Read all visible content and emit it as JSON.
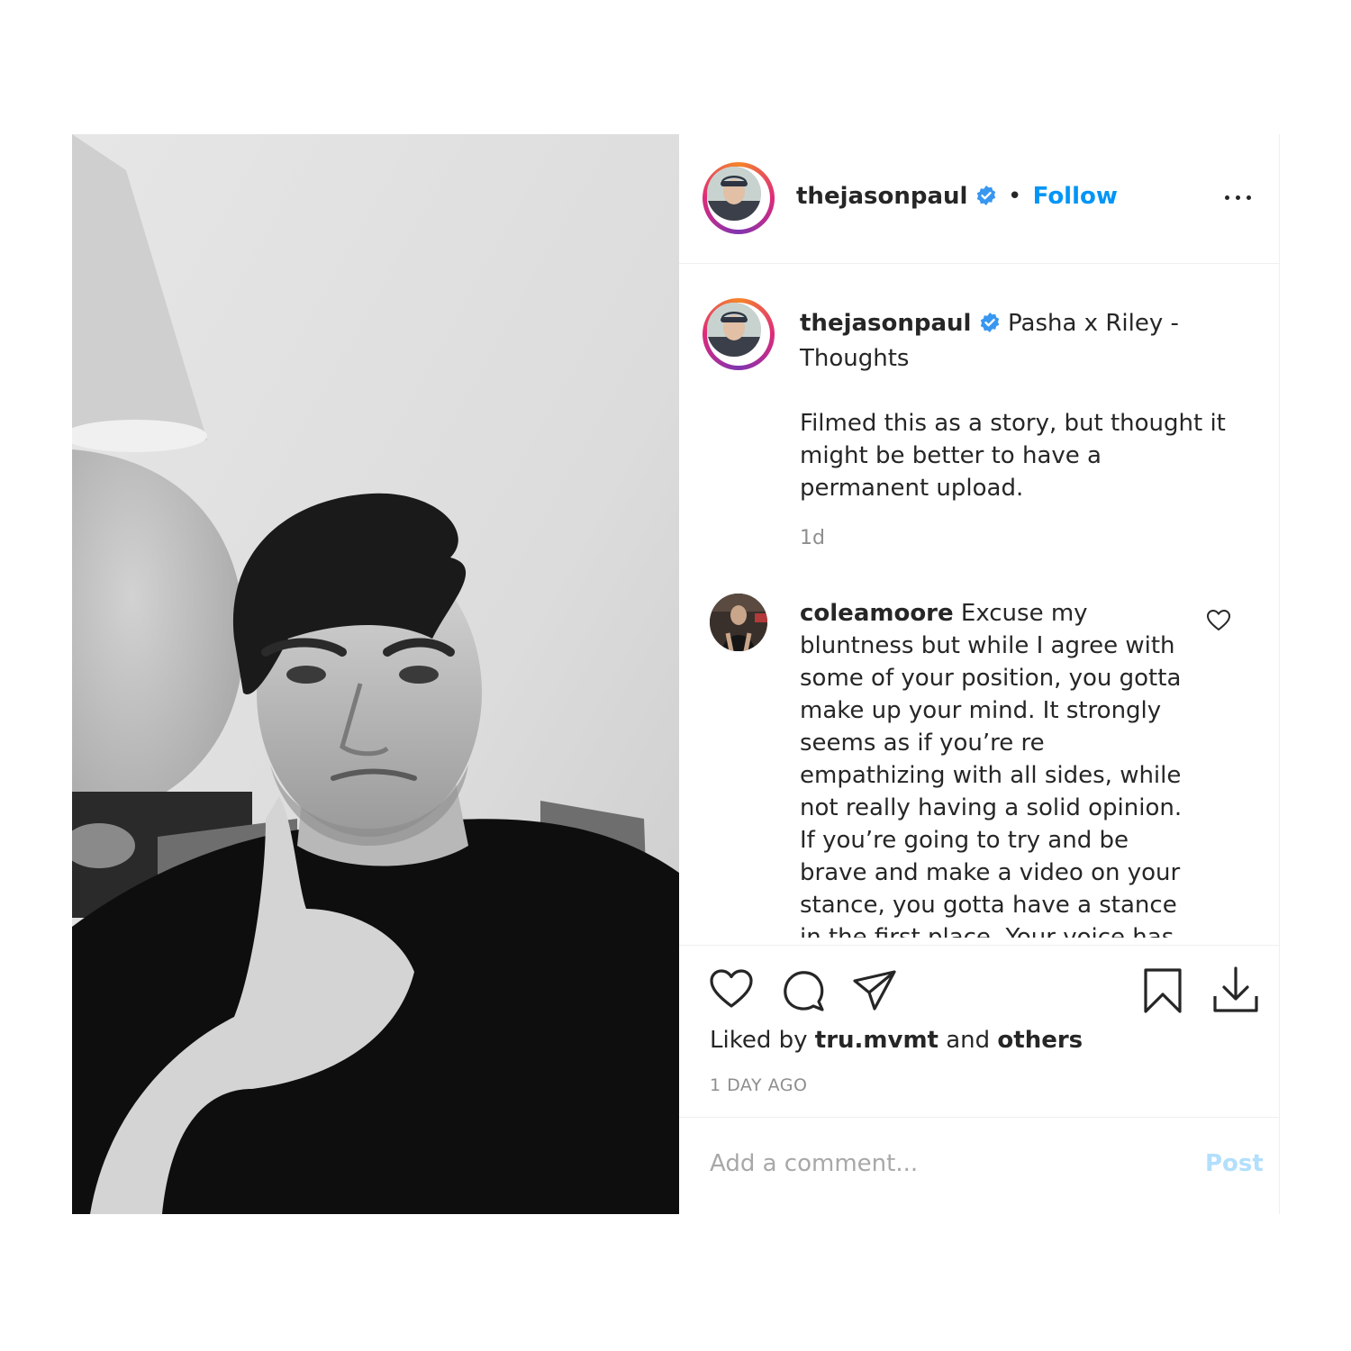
{
  "post": {
    "image_alt": "Black and white photo of a man resting his chin on his hand"
  },
  "header": {
    "username": "thejasonpaul",
    "separator": "•",
    "follow_label": "Follow",
    "more_icon": "more-options-icon"
  },
  "caption": {
    "username": "thejasonpaul",
    "title": "Pasha x Riley - Thoughts",
    "body": "Filmed this as a story, but thought it might be better to have a permanent upload.",
    "timestamp": "1d"
  },
  "comments": [
    {
      "username": "coleamoore",
      "text": "Excuse my bluntness but while I agree with some of your position, you gotta make up your mind. It strongly seems as if you’re re empathizing with all sides, while not really having a solid opinion. If you’re going to try and be brave and make a video on your stance, you gotta have a stance in the first place. Your voice has power in the"
    }
  ],
  "actions": {
    "icons": [
      "heart-icon",
      "comment-icon",
      "share-icon",
      "bookmark-icon",
      "download-icon"
    ],
    "liked_by_prefix": "Liked by",
    "liked_by_user": "tru.mvmt",
    "liked_by_and": "and",
    "liked_by_others": "others",
    "time_ago": "1 DAY AGO"
  },
  "add_comment": {
    "placeholder": "Add a comment...",
    "post_label": "Post"
  },
  "colors": {
    "accent": "#0095f6",
    "verified": "#3897f0",
    "post_disabled": "#b2dffc",
    "muted": "#8e8e8e"
  }
}
